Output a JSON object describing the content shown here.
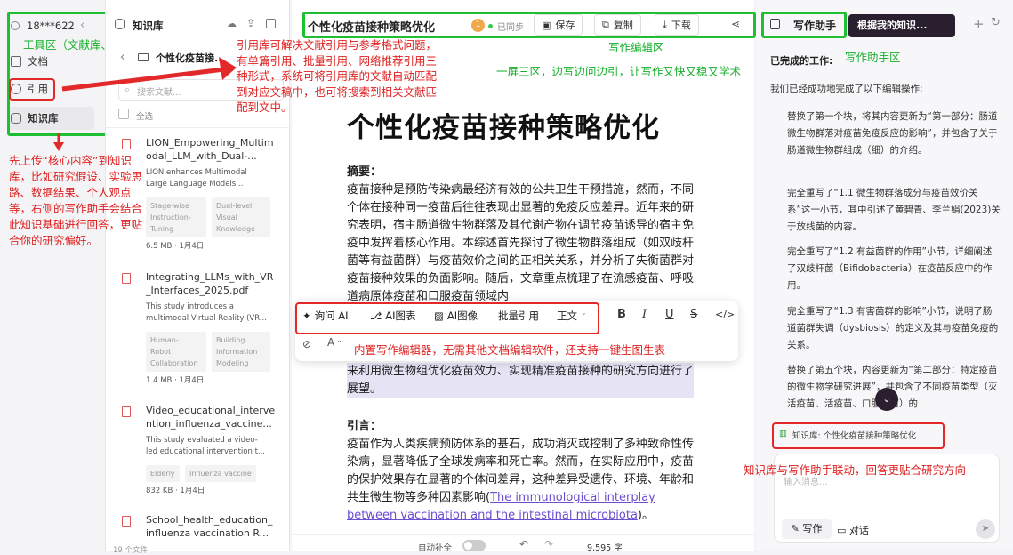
{
  "left_sidebar": {
    "account": "18***622",
    "items": [
      {
        "label": "文档",
        "icon": "document-icon"
      },
      {
        "label": "引用",
        "icon": "link-icon"
      },
      {
        "label": "知识库",
        "icon": "database-icon"
      }
    ],
    "toolbox_label": "工具区（文献库、引用库）"
  },
  "kb_panel": {
    "title": "知识库",
    "folder": "个性化疫苗接...",
    "search_placeholder": "搜索文献...",
    "select_all": "全选",
    "items": [
      {
        "title": "LION_Empowering_Multim\nodal_LLM_with_Dual-...",
        "desc": "LION enhances Multimodal\nLarge Language Models...",
        "tags": [
          "Stage-wise\nInstruction-\nTuning",
          "Dual-level\nVisual\nKnowledge"
        ],
        "meta": "6.5 MB · 1月4日"
      },
      {
        "title": "Integrating_LLMs_with_VR\n_Interfaces_2025.pdf",
        "desc": "This study introduces a\nmultimodal Virtual Reality (VR...",
        "tags": [
          "Human-\nRobot\nCollaboration",
          "Building\nInformation\nModeling"
        ],
        "meta": "1.4 MB · 1月4日"
      },
      {
        "title": "Video_educational_interve\nntion_influenza_vaccine...",
        "desc": "This study evaluated a video-\nled educational intervention t...",
        "tags": [
          "Elderly",
          "Influenza vaccine"
        ],
        "meta": "832 KB · 1月4日"
      },
      {
        "title": "School_health_education_\ninfluenza vaccination R...",
        "desc": "",
        "tags": [],
        "meta": ""
      }
    ],
    "file_count": "19 个文件"
  },
  "editor": {
    "doc_title": "个性化疫苗接种策略优化",
    "badge": "1",
    "sync_status": "已同步",
    "toolbar": {
      "save": "保存",
      "copy": "复制",
      "download": "下载"
    },
    "heading": "个性化疫苗接种策略优化",
    "abstract_label": "摘要：",
    "abstract_text": "疫苗接种是预防传染病最经济有效的公共卫生干预措施，然而，不同个体在接种同一疫苗后往往表现出显著的免疫反应差异。近年来的研究表明，宿主肠道微生物群落及其代谢产物在调节疫苗诱导的宿主免疫中发挥着核心作用。本综述首先探讨了微生物群落组成（如双歧杆菌等有益菌群）与疫苗效价之间的正相关关系，并分析了失衡菌群对疫苗接种效果的负面影响。随后，文章重点梳理了在流感疫苗、呼吸道病原体疫苗和口服疫苗领域内",
    "highlighted_text": "来利用微生物组优化疫苗效力、实现精准疫苗接种的研究方向进行了展望。",
    "intro_label": "引言：",
    "intro_text": "疫苗作为人类疾病预防体系的基石，成功消灭或控制了多种致命性传染病，显著降低了全球发病率和死亡率。然而，在实际应用中，疫苗的保护效果存在显著的个体间差异，这种差异受遗传、环境、年龄和共生微生物等多种因素影响(",
    "intro_link": "The immunological interplay between vaccination and the intestinal microbiota",
    "intro_end": ")。",
    "float_toolbar": {
      "ask_ai": "询问 AI",
      "ai_chart": "AI图表",
      "ai_image": "AI图像",
      "batch_cite": "批量引用",
      "style": "正文"
    },
    "footer": {
      "autocomplete": "自动补全",
      "word_count": "9,595 字"
    },
    "zone_label": "写作编辑区",
    "slogan": "一屏三区，边写边问边引，让写作又快又稳又学术",
    "editor_note": "内置写作编辑器，无需其他文档编辑软件，还支持一键生图生表"
  },
  "assistant": {
    "tab_active": "写作助手",
    "tab_other": "根据我的知识...",
    "zone_label": "写作助手区",
    "done_label": "已完成的工作:",
    "intro": "我们已经成功地完成了以下编辑操作:",
    "paragraphs": [
      "替换了第一个块，将其内容更新为“第一部分：肠道微生物群落对疫苗免疫反应的影响”，并包含了关于肠道微生物群组成（细）的介绍。",
      "完全重写了“1.1 微生物群落成分与疫苗效价关系”这一小节，其中引述了黄碧青、李兰娟(2023)关于放线菌的内容。",
      "完全重写了“1.2 有益菌群的作用”小节，详细阐述了双歧杆菌（Bifidobacteria）在疫苗反应中的作用。",
      "完全重写了“1.3 有害菌群的影响”小节，说明了肠道菌群失调（dysbiosis）的定义及其与疫苗免疫的关系。",
      "替换了第五个块，内容更新为“第二部分：特定疫苗的微生物学研究进展”，并包含了不同疫苗类型（灭活疫苗、活疫苗、口服疫苗）的"
    ],
    "kb_chip": "知识库: 个性化疫苗接种策略优化",
    "input_placeholder": "输入消息...",
    "mode_write": "写作",
    "mode_chat": "对话",
    "linkage_note": "知识库与写作助手联动，回答更贴合研究方向"
  },
  "annotations": {
    "citation_note": "引用库可解决文献引用与参考格式问题，有单篇引用、批量引用、网络推荐引用三种形式，系统可将引用库的文献自动匹配到对应文稿中，也可将搜索到相关文献匹配到文中。",
    "kb_note": "先上传“核心内容”到知识库，比如研究假设、实验思路、数据结果、个人观点等，右侧的写作助手会结合此知识基础进行回答，更贴合你的研究偏好。"
  },
  "colors": {
    "annotation_green": "#1fbf33",
    "annotation_red": "#e22828",
    "assistant_tab_dark": "#2a1f2e"
  }
}
